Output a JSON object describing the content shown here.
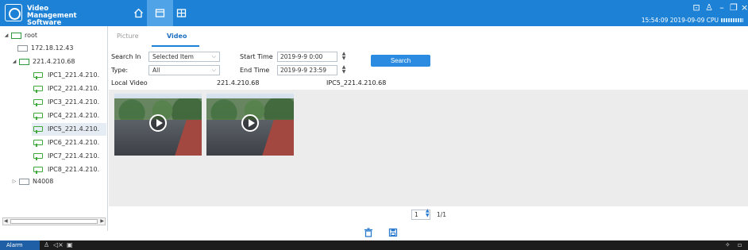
{
  "app": {
    "name": "Video Management Software",
    "clock": "15:54:09 2019-09-09 CPU"
  },
  "nav_tabs": [
    {
      "name": "home",
      "active": false
    },
    {
      "name": "playback",
      "active": true
    },
    {
      "name": "device-grid",
      "active": false
    }
  ],
  "tree": {
    "root": "root",
    "server": "172.18.12.43",
    "nvr": "221.4.210.68",
    "cameras": [
      "IPC1_221.4.210.",
      "IPC2_221.4.210.",
      "IPC3_221.4.210.",
      "IPC4_221.4.210.",
      "IPC5_221.4.210.",
      "IPC6_221.4.210.",
      "IPC7_221.4.210.",
      "IPC8_221.4.210."
    ],
    "selected_camera": "IPC5_221.4.210.",
    "other_device": "N4008"
  },
  "tabs": {
    "picture": "Picture",
    "video": "Video",
    "active": "Video"
  },
  "form": {
    "search_in_label": "Search In",
    "search_in_value": "Selected Item",
    "type_label": "Type:",
    "type_value": "All",
    "start_label": "Start Time",
    "start_value": "2019-9-9 0:00",
    "end_label": "End Time",
    "end_value": "2019-9-9 23:59",
    "search_button": "Search"
  },
  "result_info": {
    "label": "Local Video",
    "device": "221.4.210.68",
    "channel": "IPC5_221.4.210.68"
  },
  "videos": [
    {
      "thumbnail": "road-scene-video-1"
    },
    {
      "thumbnail": "road-scene-video-2"
    }
  ],
  "pager": {
    "page": "1",
    "total": "1/1"
  },
  "taskbar": {
    "alarm": "Alarm"
  },
  "colors": {
    "titlebar": "#1d82d6",
    "accent": "#2a8be0",
    "tree_icon": "#3fa83b",
    "taskbar": "#1c1c1c"
  }
}
